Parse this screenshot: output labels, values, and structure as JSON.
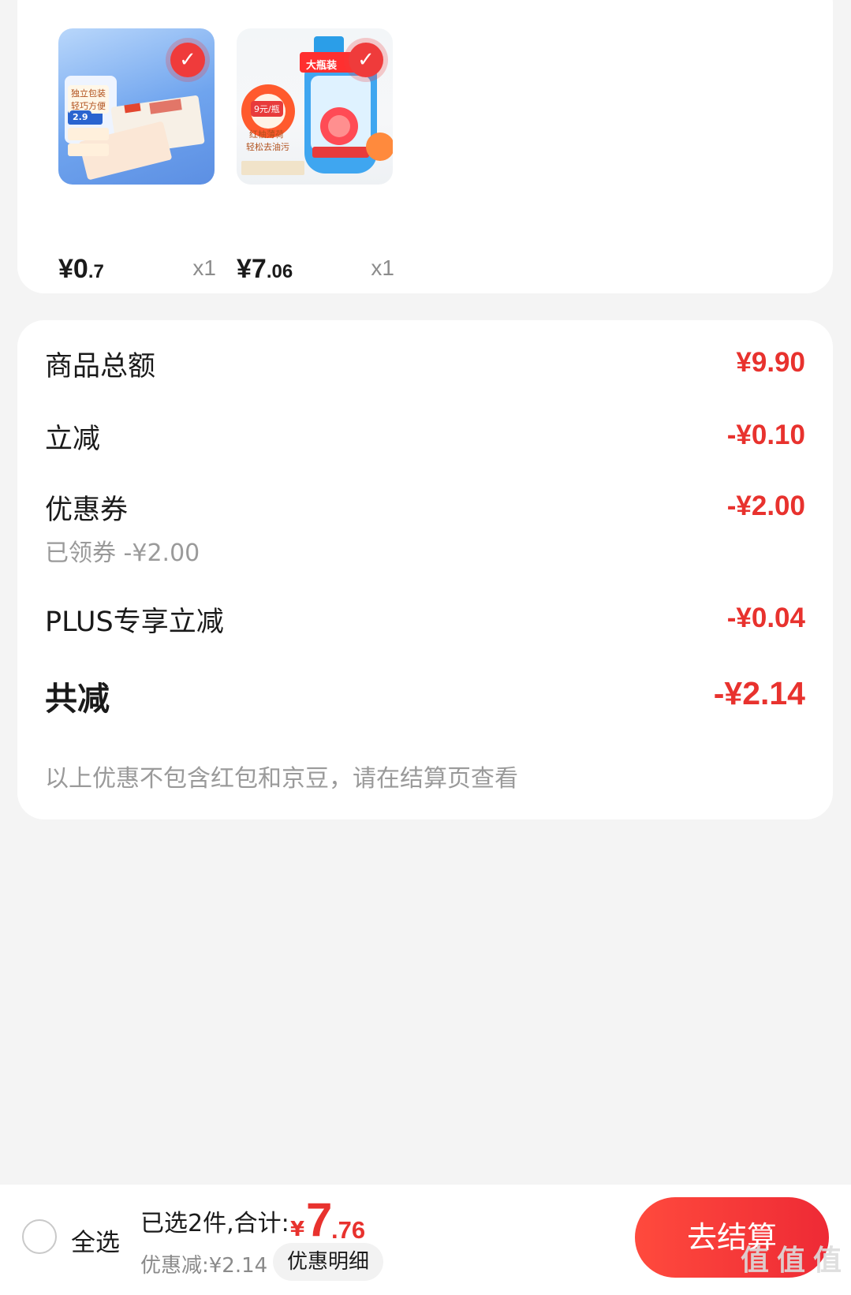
{
  "products": [
    {
      "price_int": "¥0",
      "price_dec": ".7",
      "qty": "x1"
    },
    {
      "price_int": "¥7",
      "price_dec": ".06",
      "qty": "x1"
    }
  ],
  "product_a_tags": [
    "独立包装",
    "轻巧方便",
    "2.9"
  ],
  "product_b_tags": [
    "大瓶装",
    "9元/瓶",
    "红柚薄荷",
    "轻松去油污"
  ],
  "summary": {
    "items_total_label": "商品总额",
    "items_total_value": "¥9.90",
    "instant_label": "立减",
    "instant_value": "-¥0.10",
    "coupon_label": "优惠券",
    "coupon_value": "-¥2.00",
    "coupon_sub": "已领券 -¥2.00",
    "plus_label": "PLUS专享立减",
    "plus_value": "-¥0.04",
    "total_label": "共减",
    "total_value": "-¥2.14",
    "note": "以上优惠不包含红包和京豆，请在结算页查看"
  },
  "bottombar": {
    "select_all": "全选",
    "selected_summary": "已选2件,合计:",
    "total_currency": "¥",
    "total_int": "7",
    "total_dec": ".76",
    "discount": "优惠减:¥2.14",
    "detail_button": "优惠明细",
    "checkout_button": "去结算",
    "watermark_text": "值 值 值",
    "watermark_url": "zhizhizhi.com"
  },
  "colors": {
    "accent": "#e8322e",
    "page_bg": "#f4f4f4"
  }
}
